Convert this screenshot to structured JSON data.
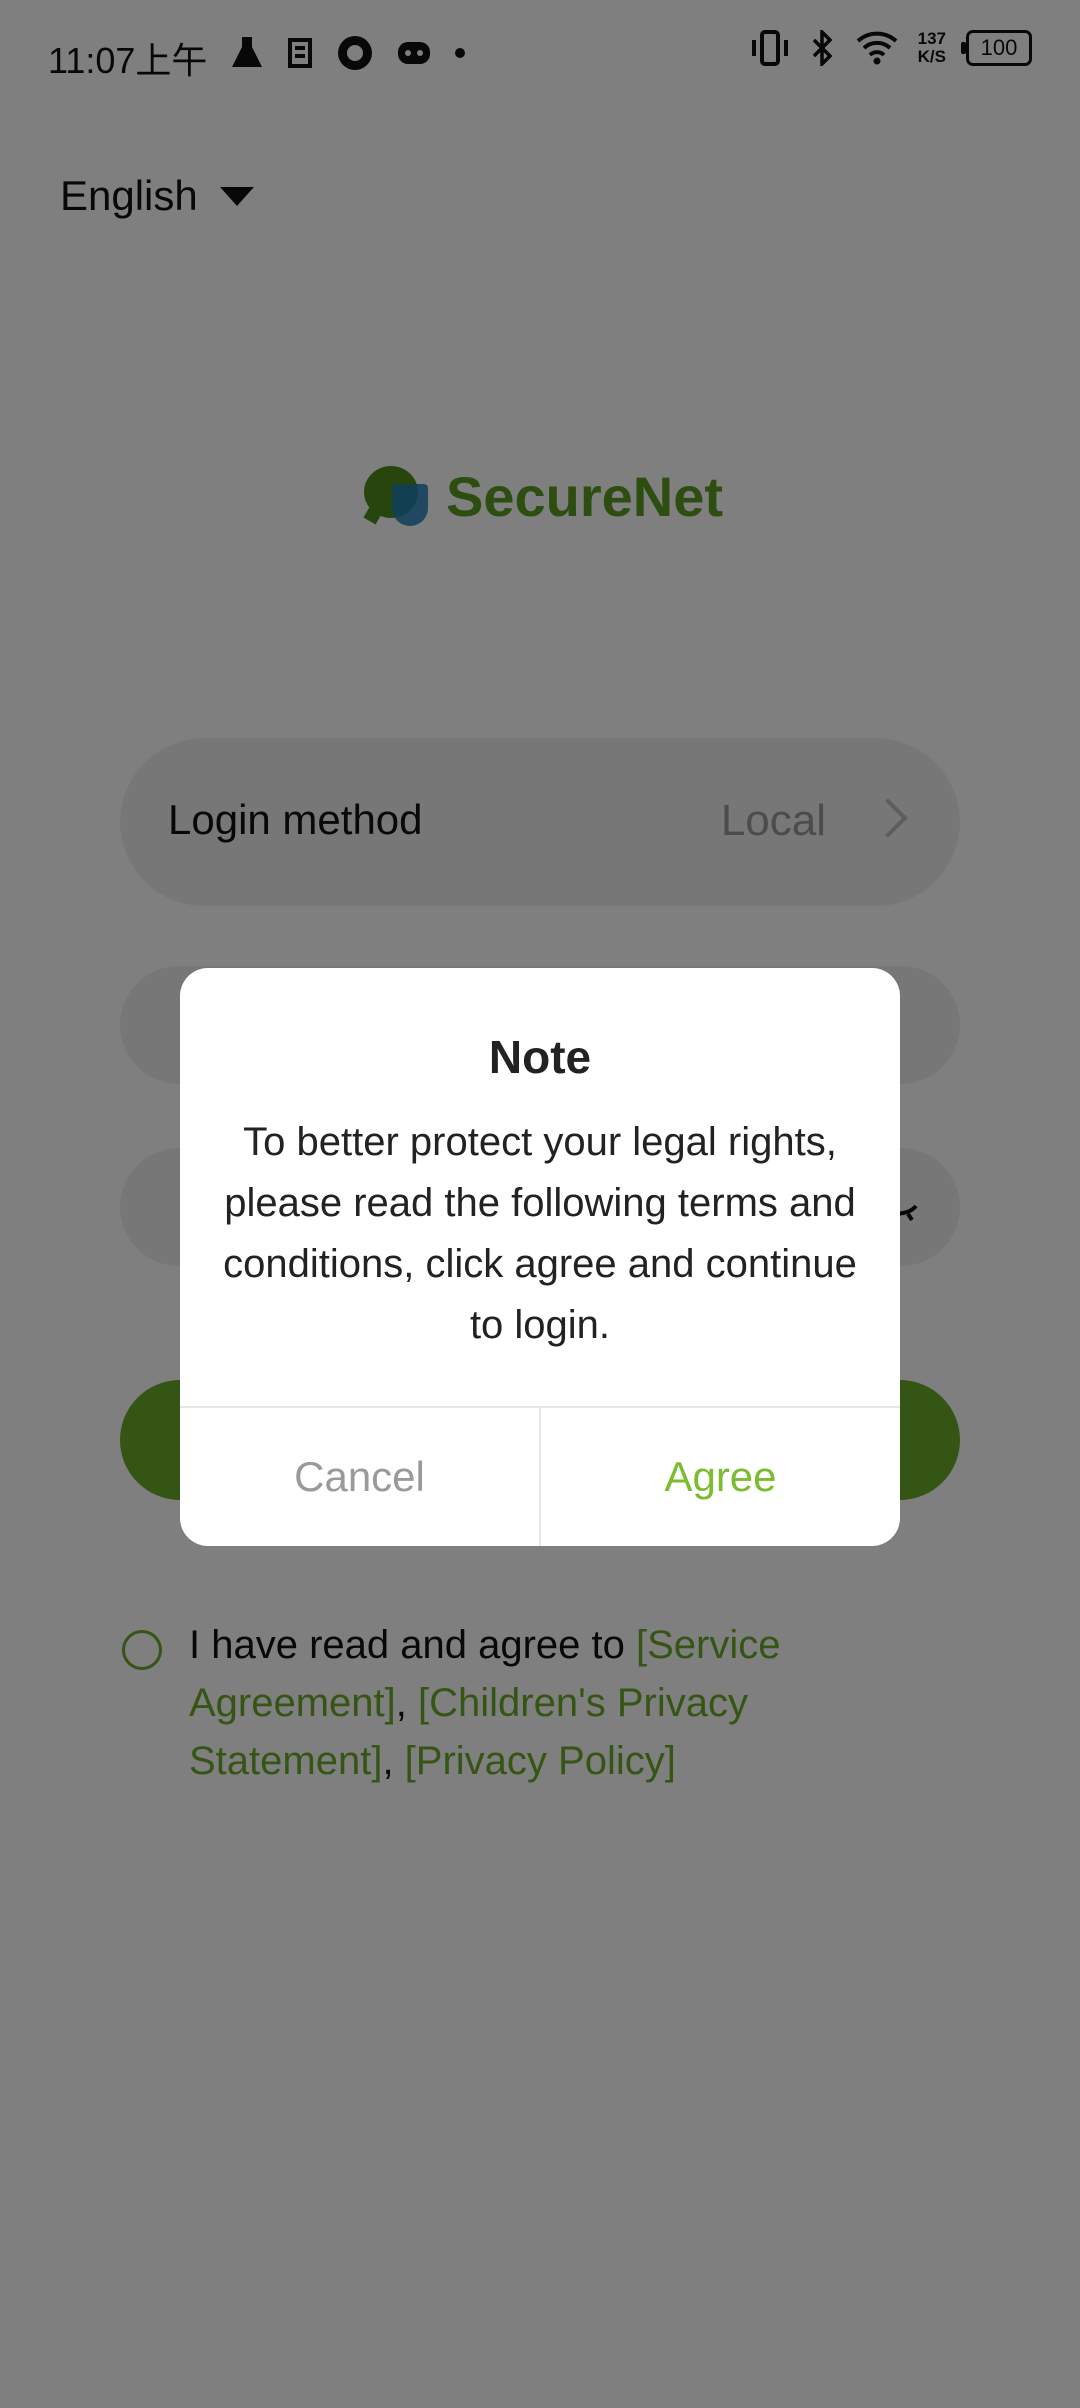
{
  "status_bar": {
    "time": "11:07上午",
    "net_speed_value": "137",
    "net_speed_unit": "K/S",
    "battery": "100",
    "icons": [
      "flask-icon",
      "cat-icon",
      "camera-shutter-icon",
      "gamepad-icon",
      "dot-icon",
      "vibrate-icon",
      "bluetooth-icon",
      "wifi-icon",
      "battery-icon"
    ]
  },
  "language": {
    "selected": "English"
  },
  "logo": {
    "text": "SecureNet",
    "colors": {
      "bubble": "#4f8c1c",
      "shield": "#1e7fb8",
      "text": "#5a9a22"
    }
  },
  "login_method": {
    "label": "Login method",
    "value": "Local"
  },
  "agreement": {
    "prefix": "I have read and agree to ",
    "service_agreement": "[Service Agreement]",
    "sep1": ", ",
    "children_privacy": "[Children's Privacy Statement]",
    "sep2": ", ",
    "privacy_policy": "[Privacy Policy]"
  },
  "dialog": {
    "title": "Note",
    "message": "To better protect your legal rights, please read the following terms and conditions, click agree and continue to login.",
    "cancel_label": "Cancel",
    "agree_label": "Agree"
  },
  "colors": {
    "accent": "#6aaa2a",
    "agree_text": "#7bbd2e",
    "cancel_text": "#9a9a9a",
    "scrim": "rgba(0,0,0,0.5)"
  }
}
